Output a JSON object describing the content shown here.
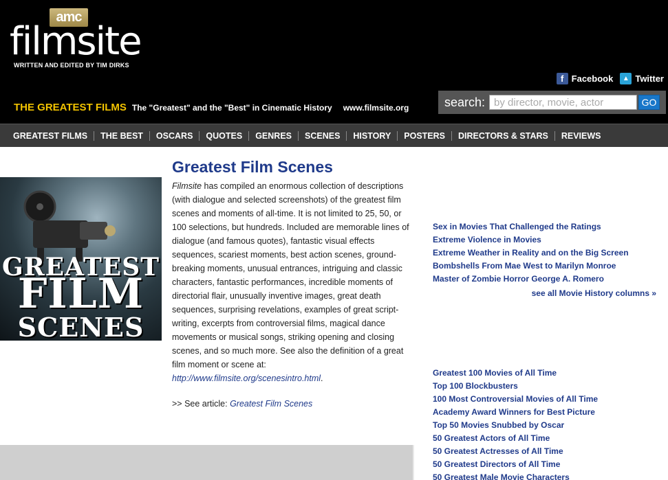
{
  "header": {
    "amc": "amc",
    "logo": "filmsite",
    "tagline": "WRITTEN AND EDITED BY TIM DIRKS",
    "title": "THE GREATEST FILMS",
    "subtitle": "The \"Greatest\" and the \"Best\" in Cinematic History",
    "url": "www.filmsite.org"
  },
  "social": {
    "facebook": "Facebook",
    "twitter": "Twitter"
  },
  "search": {
    "label": "search:",
    "placeholder": "by director, movie, actor",
    "button": "GO"
  },
  "nav": [
    "GREATEST FILMS",
    "THE BEST",
    "OSCARS",
    "QUOTES",
    "GENRES",
    "SCENES",
    "HISTORY",
    "POSTERS",
    "DIRECTORS & STARS",
    "REVIEWS"
  ],
  "hero": {
    "line1": "GREATEST",
    "line2": "FILM",
    "line3": "SCENES"
  },
  "article": {
    "title": "Greatest Film Scenes",
    "site_name": "Filmsite",
    "body": " has compiled an enormous collection of descriptions (with dialogue and selected screenshots) of the greatest film scenes and moments of all-time. It is not limited to 25, 50, or 100 selections, but hundreds. Included are memorable lines of dialogue (and famous quotes), fantastic visual effects sequences, scariest moments, best action scenes, ground-breaking moments, unusual entrances, intriguing and classic characters, fantastic performances, incredible moments of directorial flair, unusually inventive images, great death sequences, surprising revelations, examples of great script-writing, excerpts from controversial films, magical dance movements or musical songs, striking opening and closing scenes, and so much more. See also the definition of a great film moment or scene at:",
    "link": "http://www.filmsite.org/scenesintro.html",
    "link_suffix": ".",
    "see_prefix": ">> See article: ",
    "see_link": "Greatest Film Scenes"
  },
  "history_links": [
    "Sex in Movies That Challenged the Ratings",
    "Extreme Violence in Movies",
    "Extreme Weather in Reality and on the Big Screen",
    "Bombshells From Mae West to Marilyn Monroe",
    "Master of Zombie Horror George A. Romero"
  ],
  "see_all": "see all Movie History columns »",
  "list_links": [
    "Greatest 100 Movies of All Time",
    "Top 100 Blockbusters",
    "100 Most Controversial Movies of All Time",
    "Academy Award Winners for Best Picture",
    "Top 50 Movies Snubbed by Oscar",
    "50 Greatest Actors of All Time",
    "50 Greatest Actresses of All Time",
    "50 Greatest Directors of All Time",
    "50 Greatest Male Movie Characters"
  ]
}
